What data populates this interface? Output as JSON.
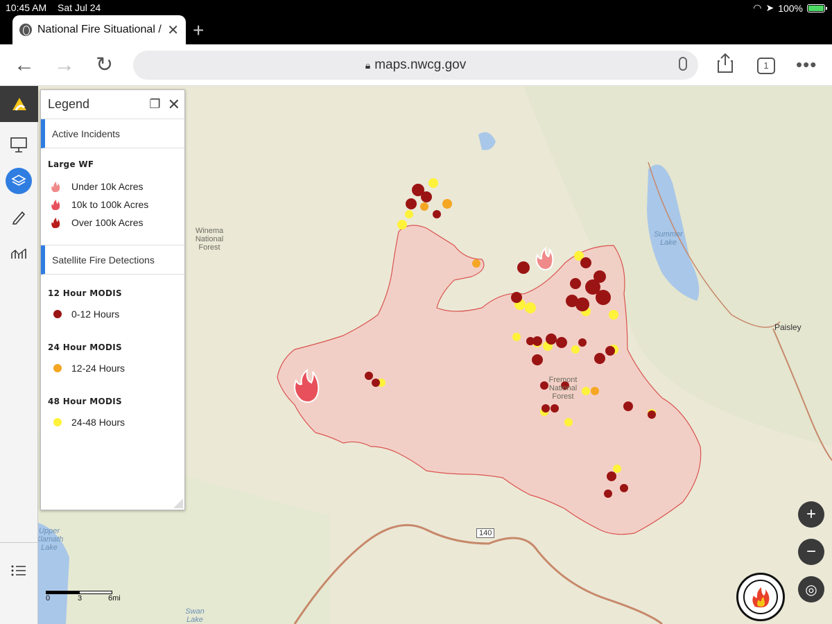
{
  "status": {
    "time": "10:45 AM",
    "date": "Sat Jul 24",
    "battery": "100%"
  },
  "browser": {
    "tab_title": "National Fire Situational /",
    "url": "maps.nwcg.gov",
    "tab_count": "1",
    "icons": [
      "globe-icon",
      "close-icon",
      "plus-icon",
      "back-icon",
      "forward-icon",
      "reload-icon",
      "lock-icon",
      "mic-icon",
      "share-icon",
      "more-icon"
    ]
  },
  "legend": {
    "title": "Legend",
    "active_incidents": "Active Incidents",
    "large_wf": "Large WF",
    "incident_items": [
      {
        "label": "Under 10k Acres",
        "color": "#f08a8a"
      },
      {
        "label": "10k to 100k Acres",
        "color": "#e8505b"
      },
      {
        "label": "Over 100k Acres",
        "color": "#b81c1c"
      }
    ],
    "satellite": "Satellite Fire Detections",
    "modis": [
      {
        "heading": "12 Hour MODIS",
        "label": "0-12 Hours",
        "color": "#9b1414"
      },
      {
        "heading": "24 Hour MODIS",
        "label": "12-24 Hours",
        "color": "#f5a623"
      },
      {
        "heading": "48 Hour MODIS",
        "label": "24-48 Hours",
        "color": "#fff23a"
      }
    ]
  },
  "map_labels": {
    "forest1": "Winema National Forest",
    "forest2": "Fremont National Forest",
    "lake1": "Summer Lake",
    "lake2": "Swan Lake",
    "lake3": "Upper Klamath Lake",
    "town": "Paisley",
    "highway": "140"
  },
  "scale": {
    "labels": [
      "0",
      "3",
      "6mi"
    ]
  },
  "colors": {
    "fire_perimeter_fill": "#f4c7c0",
    "fire_perimeter_stroke": "#d9534f",
    "accent": "#2f7de1"
  }
}
